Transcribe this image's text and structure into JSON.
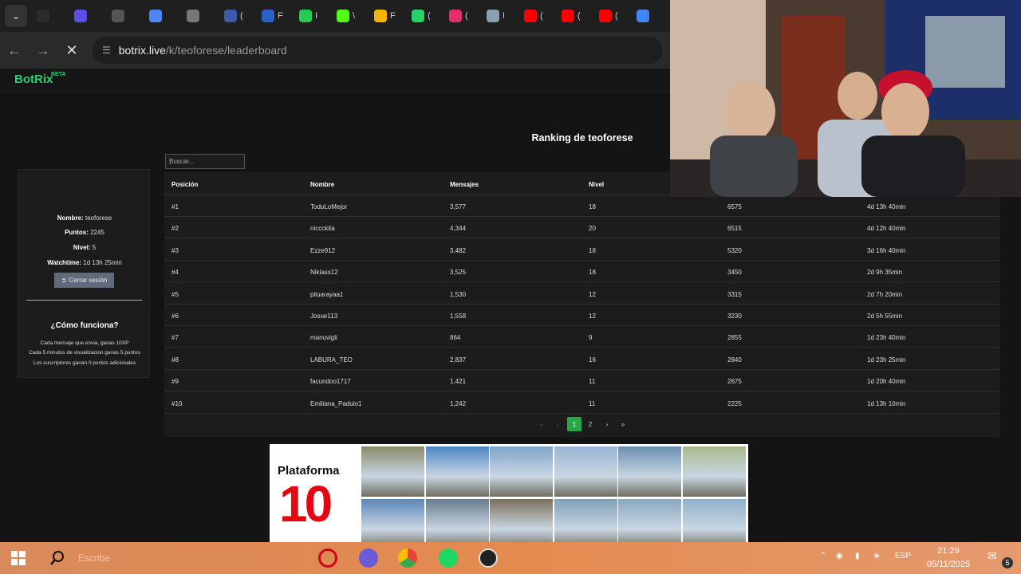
{
  "browser": {
    "tabs": [
      {
        "icon": "tab-icon-1",
        "color": "#2b2b2b",
        "text": ""
      },
      {
        "icon": "tab-icon-2",
        "color": "#5b4ee6",
        "text": ""
      },
      {
        "icon": "chatgpt-icon",
        "color": "#555555",
        "text": ""
      },
      {
        "icon": "gemini-icon",
        "color": "#4f86f7",
        "text": ""
      },
      {
        "icon": "tab-icon-p",
        "color": "#777777",
        "text": ""
      },
      {
        "icon": "tab-icon-circle",
        "color": "#3b5ba9",
        "text": "("
      },
      {
        "icon": "tab-icon-circle2",
        "color": "#2a63c5",
        "text": "F"
      },
      {
        "icon": "tab-icon-d",
        "color": "#22cc55",
        "text": "I"
      },
      {
        "icon": "kick-icon",
        "color": "#53fc18",
        "text": "\\"
      },
      {
        "icon": "drive-icon",
        "color": "#f5b400",
        "text": "F"
      },
      {
        "icon": "whatsapp-icon",
        "color": "#25d366",
        "text": "("
      },
      {
        "icon": "instagram-icon",
        "color": "#e1306c",
        "text": "("
      },
      {
        "icon": "tab-icon-shield",
        "color": "#8aa0b0",
        "text": "I"
      },
      {
        "icon": "youtube-icon",
        "color": "#ff0000",
        "text": "("
      },
      {
        "icon": "youtube-icon",
        "color": "#ff0000",
        "text": "("
      },
      {
        "icon": "youtube-icon",
        "color": "#ff0000",
        "text": "("
      },
      {
        "icon": "google-icon",
        "color": "#4285f4",
        "text": ""
      }
    ],
    "url_host": "botrix.live",
    "url_path": "/k/teoforese/leaderboard"
  },
  "site": {
    "brand": "BotRix",
    "beta": "BETA",
    "title": "Ranking de teoforese",
    "search_placeholder": "Buscar..."
  },
  "profile": {
    "name_label": "Nombre:",
    "name": "teoforese",
    "points_label": "Puntos:",
    "points": "2245",
    "level_label": "Nivel:",
    "level": "5",
    "watch_label": "Watchtime:",
    "watchtime": "1d 13h 25min",
    "logout": "Cerrar sesión",
    "how_title": "¿Cómo funciona?",
    "rules": [
      "Cada mensaje que envia, ganas 10XP",
      "Cada 5 minutos de visualizacion ganas 5 puntos",
      "Los suscriptores ganan 0 puntos adicionales"
    ]
  },
  "table": {
    "headers": [
      "Posición",
      "Nombre",
      "Mensajes",
      "Nivel"
    ],
    "rows": [
      [
        "#1",
        "TodoLoMejor",
        "3,577",
        "18",
        "6575",
        "4d 13h 40min"
      ],
      [
        "#2",
        "niccckita",
        "4,344",
        "20",
        "6515",
        "4d 12h 40min"
      ],
      [
        "#3",
        "Ezze912",
        "3,482",
        "18",
        "5320",
        "3d 16h 40min"
      ],
      [
        "#4",
        "Niklass12",
        "3,525",
        "18",
        "3450",
        "2d 9h 35min"
      ],
      [
        "#5",
        "piluarayaa1",
        "1,530",
        "12",
        "3315",
        "2d 7h 20min"
      ],
      [
        "#6",
        "Josue113",
        "1,558",
        "12",
        "3230",
        "2d 5h 55min"
      ],
      [
        "#7",
        "manuvigli",
        "864",
        "9",
        "2855",
        "1d 23h 40min"
      ],
      [
        "#8",
        "LABURA_TEO",
        "2,837",
        "16",
        "2840",
        "1d 23h 25min"
      ],
      [
        "#9",
        "facundoo1717",
        "1,421",
        "11",
        "2675",
        "1d 20h 40min"
      ],
      [
        "#10",
        "Emiliana_Padulo1",
        "1,242",
        "11",
        "2225",
        "1d 13h 10min"
      ]
    ],
    "pagination": {
      "first": "«",
      "prev": "‹",
      "pages": [
        "1",
        "2"
      ],
      "active": "1",
      "next": "›",
      "last": "»"
    }
  },
  "ad": {
    "brand": "Plataforma",
    "brand_number": "10"
  },
  "taskbar": {
    "search_placeholder": "Escribe",
    "lang": "ESP",
    "time": "21:29",
    "date": "05/11/2025",
    "notifications": "5",
    "accent": "#e48a4e"
  }
}
